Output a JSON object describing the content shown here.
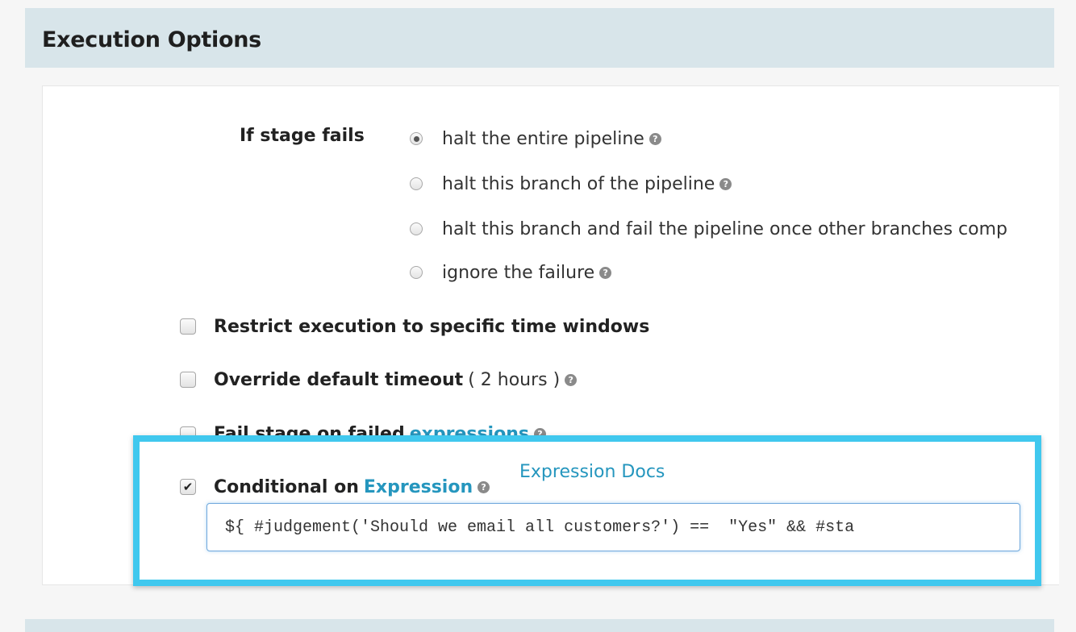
{
  "section": {
    "title": "Execution Options"
  },
  "if_stage_fails": {
    "label": "If stage fails",
    "options": [
      {
        "label": "halt the entire pipeline",
        "checked": true,
        "help": true
      },
      {
        "label": "halt this branch of the pipeline",
        "checked": false,
        "help": true
      },
      {
        "label": "halt this branch and fail the pipeline once other branches comp",
        "checked": false,
        "help": false
      },
      {
        "label": "ignore the failure",
        "checked": false,
        "help": true
      }
    ]
  },
  "restrict_windows": {
    "label": "Restrict execution to specific time windows",
    "checked": false
  },
  "override_timeout": {
    "label": "Override default timeout",
    "extra": "( 2 hours )",
    "checked": false
  },
  "fail_on_expressions": {
    "label": "Fail stage on failed",
    "link": "expressions",
    "checked": false
  },
  "conditional": {
    "label": "Conditional on",
    "link": "Expression",
    "checked": true,
    "docs_link": "Expression Docs",
    "expression": "${ #judgement('Should we email all customers?') ==  \"Yes\" && #sta"
  },
  "icons": {
    "help": "question-circle-icon",
    "check": "checkmark-icon"
  },
  "colors": {
    "header_bg": "#d8e5ea",
    "highlight_border": "#40c8ee",
    "link": "#2596be"
  }
}
